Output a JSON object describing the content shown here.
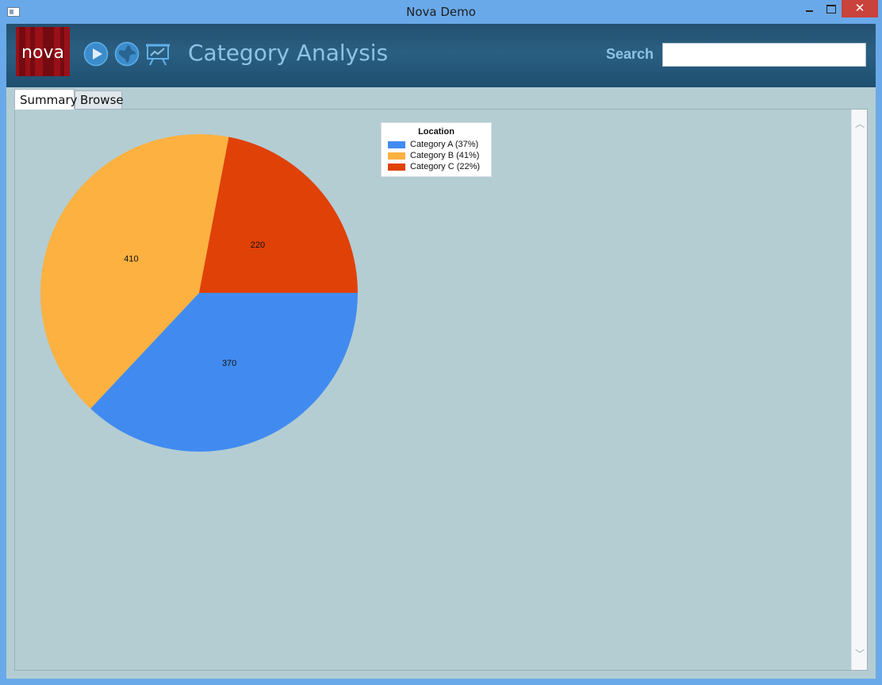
{
  "window": {
    "title": "Nova Demo",
    "close_glyph": "✕"
  },
  "header": {
    "logo_text": "nova",
    "title": "Category Analysis",
    "search_label": "Search",
    "search_value": "",
    "icons": [
      "play-icon",
      "globe-icon",
      "presentation-chart-icon"
    ]
  },
  "tabs": [
    {
      "label": "Summary",
      "active": true
    },
    {
      "label": "Browse",
      "active": false
    }
  ],
  "scroll": {
    "up": "︿",
    "down": "﹀"
  },
  "colors": {
    "category_a": "#418bf0",
    "category_b": "#fcb140",
    "category_c": "#e04107",
    "panel_bg": "#b4cdd3"
  },
  "chart_data": {
    "type": "pie",
    "legend_title": "Location",
    "legend_position": "top-right",
    "slices": [
      {
        "label": "Category A",
        "value": 370,
        "percent_label": "Category A (37%)",
        "color": "#418bf0"
      },
      {
        "label": "Category B",
        "value": 410,
        "percent_label": "Category B (41%)",
        "color": "#fcb140"
      },
      {
        "label": "Category C",
        "value": 220,
        "percent_label": "Category C (22%)",
        "color": "#e04107"
      }
    ]
  }
}
